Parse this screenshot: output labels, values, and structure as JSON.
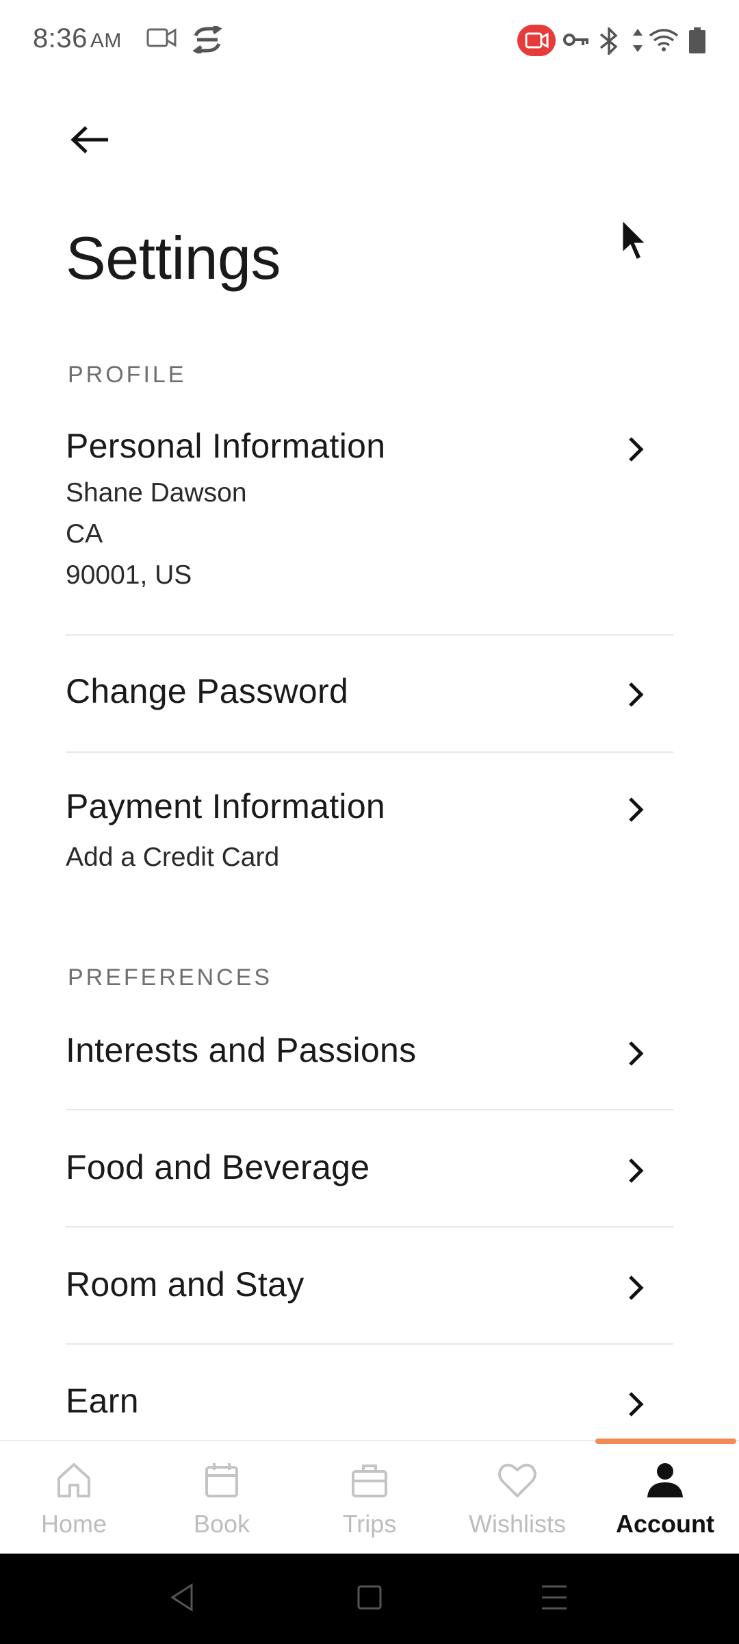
{
  "status_bar": {
    "time": "8:36",
    "ampm": "AM",
    "icons": [
      "video-camera-icon",
      "sync-icon",
      "screen-record-icon",
      "key-icon",
      "bluetooth-icon",
      "data-arrows-icon",
      "wifi-icon",
      "battery-icon"
    ]
  },
  "header": {
    "back_icon": "arrow-left-icon",
    "title": "Settings"
  },
  "sections": {
    "profile": {
      "label": "PROFILE",
      "personal": {
        "label": "Personal Information",
        "name": "Shane Dawson",
        "state": "CA",
        "postal": "90001, US"
      },
      "password": {
        "label": "Change Password"
      },
      "payment": {
        "label": "Payment Information",
        "sub": "Add a Credit Card"
      }
    },
    "preferences": {
      "label": "PREFERENCES",
      "interests": {
        "label": "Interests and Passions"
      },
      "food": {
        "label": "Food and Beverage"
      },
      "room": {
        "label": "Room and Stay"
      },
      "earn": {
        "label": "Earn"
      }
    }
  },
  "bottom_nav": {
    "items": [
      {
        "label": "Home",
        "icon": "home-icon"
      },
      {
        "label": "Book",
        "icon": "calendar-icon"
      },
      {
        "label": "Trips",
        "icon": "briefcase-icon"
      },
      {
        "label": "Wishlists",
        "icon": "heart-icon"
      },
      {
        "label": "Account",
        "icon": "person-icon"
      }
    ],
    "active": "Account",
    "accent_color": "#f28a55"
  }
}
